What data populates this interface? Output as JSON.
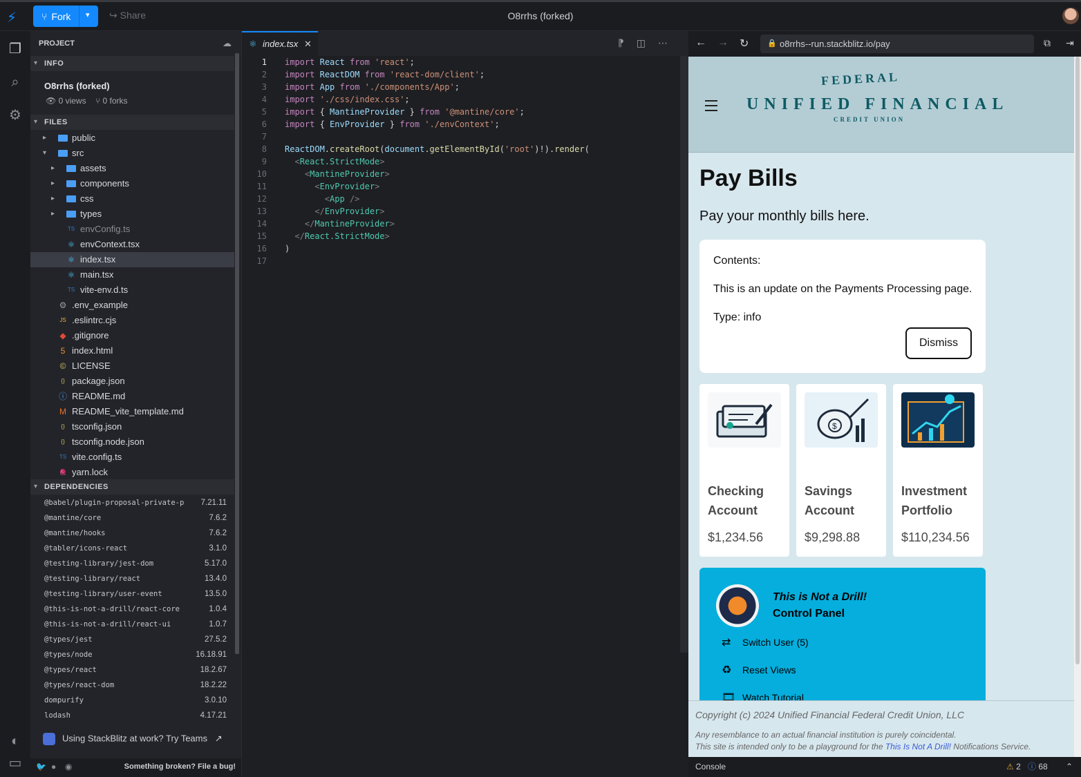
{
  "topbar": {
    "fork_label": "Fork",
    "share_label": "Share",
    "title": "O8rrhs (forked)"
  },
  "sidebar": {
    "project_label": "PROJECT",
    "info_label": "INFO",
    "project_name": "O8rrhs (forked)",
    "views": "0 views",
    "forks": "0 forks",
    "files_label": "FILES",
    "files": [
      {
        "name": "public",
        "kind": "folder",
        "depth": 0,
        "arrow": "▸"
      },
      {
        "name": "src",
        "kind": "folder-open",
        "depth": 0,
        "arrow": "▾"
      },
      {
        "name": "assets",
        "kind": "folder",
        "depth": 1,
        "arrow": "▸"
      },
      {
        "name": "components",
        "kind": "folder",
        "depth": 1,
        "arrow": "▸"
      },
      {
        "name": "css",
        "kind": "folder",
        "depth": 1,
        "arrow": "▸"
      },
      {
        "name": "types",
        "kind": "folder",
        "depth": 1,
        "arrow": "▸"
      },
      {
        "name": "envConfig.ts",
        "kind": "ts",
        "depth": 1,
        "muted": true
      },
      {
        "name": "envContext.tsx",
        "kind": "react",
        "depth": 1
      },
      {
        "name": "index.tsx",
        "kind": "react",
        "depth": 1,
        "selected": true
      },
      {
        "name": "main.tsx",
        "kind": "react",
        "depth": 1
      },
      {
        "name": "vite-env.d.ts",
        "kind": "ts",
        "depth": 1
      },
      {
        "name": ".env_example",
        "kind": "gear",
        "depth": 0
      },
      {
        "name": ".eslintrc.cjs",
        "kind": "js",
        "depth": 0
      },
      {
        "name": ".gitignore",
        "kind": "git",
        "depth": 0
      },
      {
        "name": "index.html",
        "kind": "html",
        "depth": 0
      },
      {
        "name": "LICENSE",
        "kind": "license",
        "depth": 0
      },
      {
        "name": "package.json",
        "kind": "json",
        "depth": 0
      },
      {
        "name": "README.md",
        "kind": "info",
        "depth": 0
      },
      {
        "name": "README_vite_template.md",
        "kind": "md",
        "depth": 0
      },
      {
        "name": "tsconfig.json",
        "kind": "json",
        "depth": 0
      },
      {
        "name": "tsconfig.node.json",
        "kind": "json",
        "depth": 0
      },
      {
        "name": "vite.config.ts",
        "kind": "ts",
        "depth": 0
      },
      {
        "name": "yarn.lock",
        "kind": "yarn",
        "depth": 0
      }
    ],
    "deps_label": "DEPENDENCIES",
    "dependencies": [
      {
        "name": "@babel/plugin-proposal-private-p",
        "version": "7.21.11"
      },
      {
        "name": "@mantine/core",
        "version": "7.6.2"
      },
      {
        "name": "@mantine/hooks",
        "version": "7.6.2"
      },
      {
        "name": "@tabler/icons-react",
        "version": "3.1.0"
      },
      {
        "name": "@testing-library/jest-dom",
        "version": "5.17.0"
      },
      {
        "name": "@testing-library/react",
        "version": "13.4.0"
      },
      {
        "name": "@testing-library/user-event",
        "version": "13.5.0"
      },
      {
        "name": "@this-is-not-a-drill/react-core",
        "version": "1.0.4"
      },
      {
        "name": "@this-is-not-a-drill/react-ui",
        "version": "1.0.7"
      },
      {
        "name": "@types/jest",
        "version": "27.5.2"
      },
      {
        "name": "@types/node",
        "version": "16.18.91"
      },
      {
        "name": "@types/react",
        "version": "18.2.67"
      },
      {
        "name": "@types/react-dom",
        "version": "18.2.22"
      },
      {
        "name": "dompurify",
        "version": "3.0.10"
      },
      {
        "name": "lodash",
        "version": "4.17.21"
      }
    ],
    "teams_text": "Using StackBlitz at work? Try Teams",
    "bug_text": "Something broken? File a bug!"
  },
  "editor": {
    "tab_label": "index.tsx",
    "lines": [
      "<span class=\"k\">import</span> <span class=\"v\">React</span> <span class=\"k\">from</span> <span class=\"s\">'react'</span>;",
      "<span class=\"k\">import</span> <span class=\"v\">ReactDOM</span> <span class=\"k\">from</span> <span class=\"s\">'react-dom/client'</span>;",
      "<span class=\"k\">import</span> <span class=\"v\">App</span> <span class=\"k\">from</span> <span class=\"s\">'./components/App'</span>;",
      "<span class=\"k\">import</span> <span class=\"s\">'./css/index.css'</span>;",
      "<span class=\"k\">import</span> { <span class=\"v\">MantineProvider</span> } <span class=\"k\">from</span> <span class=\"s\">'@mantine/core'</span>;",
      "<span class=\"k\">import</span> { <span class=\"v\">EnvProvider</span> } <span class=\"k\">from</span> <span class=\"s\">'./envContext'</span>;",
      "",
      "<span class=\"v\">ReactDOM</span>.<span class=\"f\">createRoot</span>(<span class=\"v\">document</span>.<span class=\"f\">getElementById</span>(<span class=\"s\">'root'</span>)!).<span class=\"f\">render</span>(",
      "  <span class=\"g\">&lt;</span><span class=\"t\">React.StrictMode</span><span class=\"g\">&gt;</span>",
      "    <span class=\"g\">&lt;</span><span class=\"t\">MantineProvider</span><span class=\"g\">&gt;</span>",
      "      <span class=\"g\">&lt;</span><span class=\"t\">EnvProvider</span><span class=\"g\">&gt;</span>",
      "        <span class=\"g\">&lt;</span><span class=\"t\">App</span> <span class=\"g\">/&gt;</span>",
      "      <span class=\"g\">&lt;/</span><span class=\"t\">EnvProvider</span><span class=\"g\">&gt;</span>",
      "    <span class=\"g\">&lt;/</span><span class=\"t\">MantineProvider</span><span class=\"g\">&gt;</span>",
      "  <span class=\"g\">&lt;/</span><span class=\"t\">React.StrictMode</span><span class=\"g\">&gt;</span>",
      ")",
      ""
    ]
  },
  "preview": {
    "url": "o8rrhs--run.stackblitz.io/pay",
    "brand": {
      "federal": "FEDERAL",
      "main": "UNIFIED FINANCIAL",
      "cu": "CREDIT UNION"
    },
    "heading": "Pay Bills",
    "lead": "Pay your monthly bills here.",
    "notice": {
      "contents": "Contents:",
      "message": "This is an update on the Payments Processing page.",
      "type": "Type: info",
      "dismiss": "Dismiss"
    },
    "accounts": [
      {
        "name": "Checking Account",
        "amount": "$1,234.56"
      },
      {
        "name": "Savings Account",
        "amount": "$9,298.88"
      },
      {
        "name": "Investment Portfolio",
        "amount": "$110,234.56"
      }
    ],
    "drill": {
      "title1": "This is Not a Drill!",
      "title2": "Control Panel",
      "switch_user": "Switch User (5)",
      "reset_views": "Reset Views",
      "watch_tutorial": "Watch Tutorial"
    },
    "footer": {
      "copyright": "Copyright (c) 2024 Unified Financial Federal Credit Union, LLC",
      "disclaimer1": "Any resemblance to an actual financial institution is purely coincidental.",
      "disclaimer2_pre": "This site is intended only to be a playground for the ",
      "disclaimer2_link": "This Is Not A Drill!",
      "disclaimer2_post": " Notifications Service."
    },
    "console": {
      "label": "Console",
      "warnings": "2",
      "infos": "68"
    }
  }
}
